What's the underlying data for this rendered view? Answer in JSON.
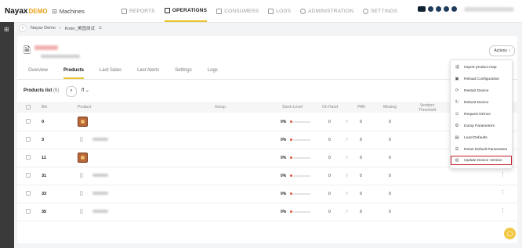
{
  "app": {
    "brand": "Nayax",
    "brand_suffix": "DEMO",
    "section": "Machines"
  },
  "nav": [
    {
      "label": "REPORTS",
      "active": false
    },
    {
      "label": "OPERATIONS",
      "active": true
    },
    {
      "label": "CONSUMERS",
      "active": false
    },
    {
      "label": "LOGS",
      "active": false
    },
    {
      "label": "ADMINISTRATION",
      "active": false
    },
    {
      "label": "SETTINGS",
      "active": false
    }
  ],
  "breadcrumb": {
    "root": "Nayax Demo",
    "current": "Koter_美国测试"
  },
  "header": {
    "actions_label": "Actions"
  },
  "tabs": [
    "Overview",
    "Products",
    "Last Sales",
    "Last Alerts",
    "Settings",
    "Logs"
  ],
  "active_tab": "Products",
  "products": {
    "title": "Products list",
    "count": "(6)",
    "filter_label": "ff"
  },
  "table": {
    "headers": {
      "bin": "Bin",
      "product": "Product",
      "group": "Group",
      "stock": "Stock Level",
      "onhand": "On Hand",
      "par": "PAR",
      "missing": "Missing",
      "vendors_line1": "Vendors",
      "vendors_line2": "Threshold"
    },
    "rows": [
      {
        "bin": "0",
        "thumb": "image",
        "stock": "0%",
        "onhand": "0",
        "par": "0",
        "missing": "0"
      },
      {
        "bin": "3",
        "thumb": "bottle",
        "stock": "0%",
        "onhand": "0",
        "par": "0",
        "missing": "0"
      },
      {
        "bin": "11",
        "thumb": "image",
        "stock": "0%",
        "onhand": "0",
        "par": "0",
        "missing": "0"
      },
      {
        "bin": "31",
        "thumb": "bottle",
        "stock": "0%",
        "onhand": "0",
        "par": "0",
        "missing": "0"
      },
      {
        "bin": "33",
        "thumb": "bottle",
        "stock": "0%",
        "onhand": "0",
        "par": "0",
        "missing": "0"
      },
      {
        "bin": "35",
        "thumb": "bottle",
        "stock": "0%",
        "onhand": "0",
        "par": "0",
        "missing": "0"
      }
    ]
  },
  "actions_menu": [
    {
      "label": "Import product map",
      "icon": "import-icon"
    },
    {
      "label": "Reload Configuration",
      "icon": "reload-config-icon"
    },
    {
      "label": "Restart Device",
      "icon": "restart-icon"
    },
    {
      "label": "Reboot Device",
      "icon": "reboot-icon"
    },
    {
      "label": "Request DHnce",
      "icon": "request-icon"
    },
    {
      "label": "Dump Parameters",
      "icon": "dump-icon"
    },
    {
      "label": "Load Defaults",
      "icon": "load-defaults-icon"
    },
    {
      "label": "Reset Default Parameters",
      "icon": "reset-icon"
    },
    {
      "label": "Update Device Version",
      "icon": "update-icon",
      "highlighted": true
    }
  ],
  "colors": {
    "accent": "#e8c32a",
    "brand_demo": "#e8a317",
    "highlight_box": "#c0202a",
    "rail": "#3a3a3a"
  }
}
